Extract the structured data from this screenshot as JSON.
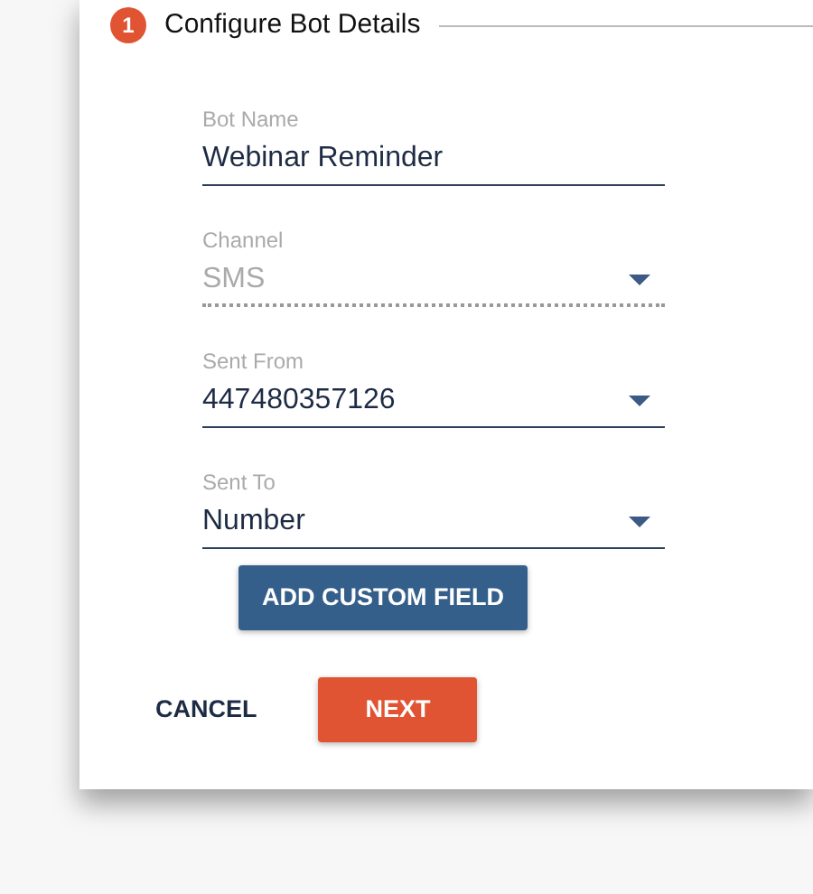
{
  "step": {
    "number": "1",
    "title": "Configure Bot Details"
  },
  "fields": [
    {
      "kind": "text",
      "label": "Bot Name",
      "value": "Webinar Reminder",
      "disabled": false
    },
    {
      "kind": "select",
      "label": "Channel",
      "value": "SMS",
      "disabled": true
    },
    {
      "kind": "select",
      "label": "Sent From",
      "value": "447480357126",
      "disabled": false
    },
    {
      "kind": "select",
      "label": "Sent To",
      "value": "Number",
      "disabled": false
    }
  ],
  "add_button": "ADD CUSTOM FIELD",
  "actions": {
    "cancel": "CANCEL",
    "next": "NEXT"
  }
}
